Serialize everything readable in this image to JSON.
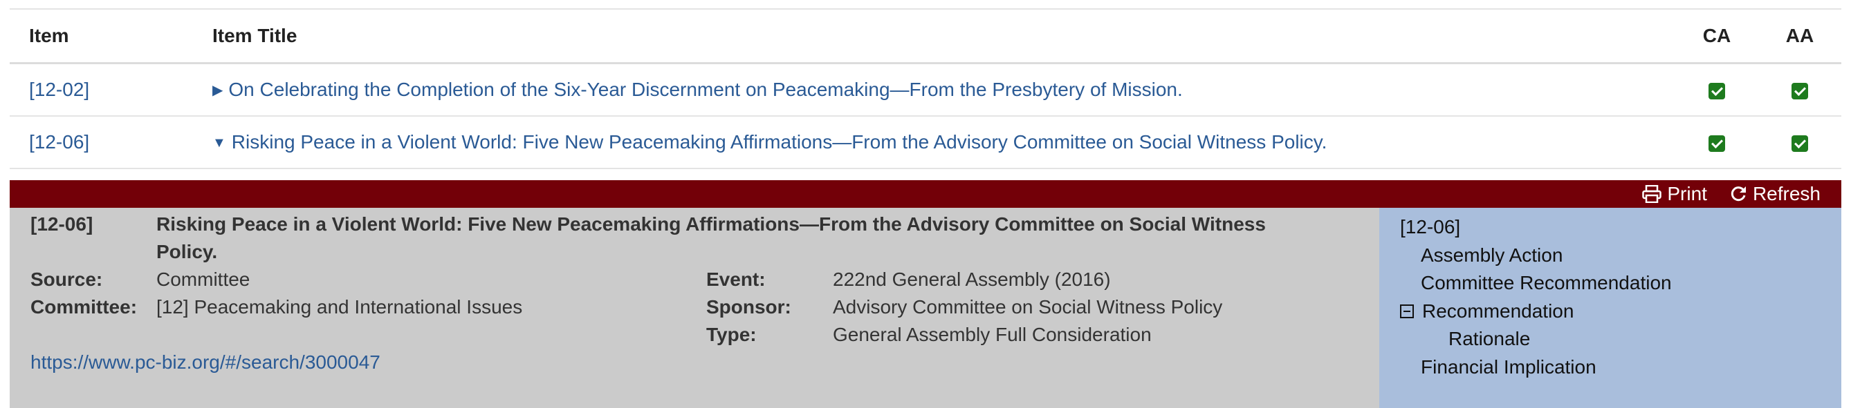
{
  "table": {
    "headers": {
      "item": "Item",
      "title": "Item Title",
      "ca": "CA",
      "aa": "AA"
    },
    "rows": [
      {
        "item": "[12-02]",
        "title": "On Celebrating the Completion of the Six-Year Discernment on Peacemaking—From the Presbytery of Mission.",
        "expanded": false
      },
      {
        "item": "[12-06]",
        "title": "Risking Peace in a Violent World: Five New Peacemaking Affirmations—From the Advisory Committee on Social Witness Policy.",
        "expanded": true
      }
    ]
  },
  "toolbar": {
    "print": "Print",
    "refresh": "Refresh",
    "print_icon": "print-icon",
    "refresh_icon": "refresh-icon"
  },
  "detail": {
    "number": "[12-06]",
    "title_line1": "Risking Peace in a Violent World: Five New Peacemaking Affirmations—From the Advisory Committee on Social Witness",
    "title_line2": "Policy.",
    "source_label": "Source:",
    "source": "Committee",
    "committee_label": "Committee:",
    "committee": "[12] Peacemaking and International Issues",
    "event_label": "Event:",
    "event": "222nd General Assembly (2016)",
    "sponsor_label": "Sponsor:",
    "sponsor": "Advisory Committee on Social Witness Policy",
    "type_label": "Type:",
    "type": "General Assembly Full Consideration",
    "link": "https://www.pc-biz.org/#/search/3000047"
  },
  "toc": {
    "number": "[12-06]",
    "items": [
      "Assembly Action",
      "Committee Recommendation",
      "Recommendation",
      "Rationale",
      "Financial Implication"
    ]
  },
  "colors": {
    "bar": "#730008",
    "left_panel": "#cbcbcb",
    "right_panel": "#a9bedc",
    "link": "#2a5a95",
    "check": "#1e7b1e"
  }
}
